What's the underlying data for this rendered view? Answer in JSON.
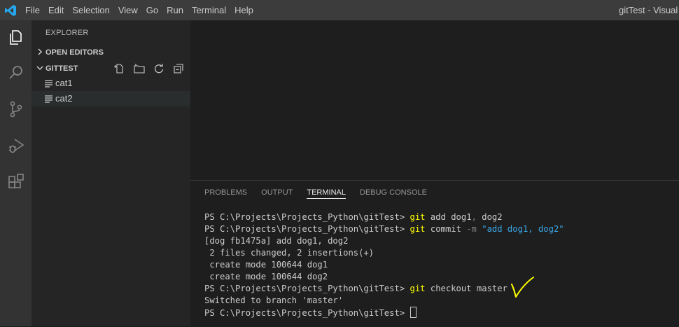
{
  "titlebar": {
    "menu": [
      "File",
      "Edit",
      "Selection",
      "View",
      "Go",
      "Run",
      "Terminal",
      "Help"
    ],
    "window_title": "gitTest - Visual S"
  },
  "activity_bar": {
    "icons": [
      "explorer-icon",
      "search-icon",
      "source-control-icon",
      "run-debug-icon",
      "extensions-icon"
    ]
  },
  "sidebar": {
    "title": "EXPLORER",
    "open_editors": "OPEN EDITORS",
    "folder": "GITTEST",
    "files": [
      "cat1",
      "cat2"
    ]
  },
  "panel": {
    "tabs": [
      "PROBLEMS",
      "OUTPUT",
      "TERMINAL",
      "DEBUG CONSOLE"
    ],
    "active_tab": "TERMINAL"
  },
  "terminal": {
    "prompt": "PS C:\\Projects\\Projects_Python\\gitTest> ",
    "line1": {
      "cmd": "git",
      "args": " add dog1",
      "sep": ",",
      "args2": " dog2"
    },
    "line2": {
      "cmd": "git",
      "args": " commit ",
      "flag": "-m",
      "str": " \"add dog1, dog2\""
    },
    "out": [
      "[dog fb1475a] add dog1, dog2",
      " 2 files changed, 2 insertions(+)",
      " create mode 100644 dog1",
      " create mode 100644 dog2"
    ],
    "line7": {
      "cmd": "git",
      "args": " checkout master"
    },
    "switched": "Switched to branch 'master'"
  },
  "colors": {
    "titlebar": "#3c3c3c",
    "activity_bar": "#333333",
    "sidebar": "#252526",
    "editor": "#1e1e1e",
    "command": "#ffff00",
    "string": "#3aa7e8",
    "annotation": "#ffff00"
  }
}
